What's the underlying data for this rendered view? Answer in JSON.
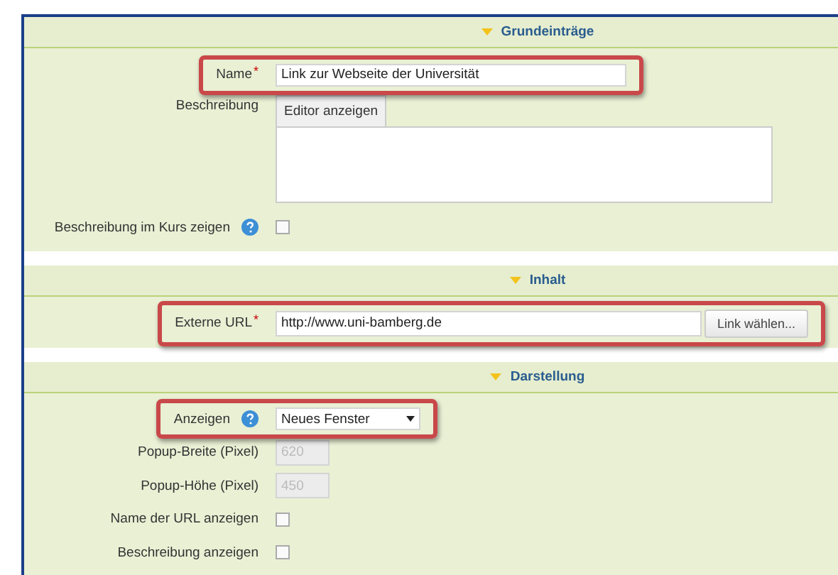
{
  "sections": [
    {
      "title": "Grundeinträge",
      "expanded": true,
      "fields": [
        {
          "kind": "text",
          "label": "Name",
          "required_mark": "*",
          "value": "Link zur Webseite der Universität",
          "highlighted": true
        },
        {
          "kind": "editor",
          "label": "Beschreibung",
          "tab": "Editor anzeigen"
        },
        {
          "kind": "checkbox",
          "label": "Beschreibung im Kurs zeigen",
          "help": true,
          "checked": false
        }
      ]
    },
    {
      "title": "Inhalt",
      "expanded": true,
      "fields": [
        {
          "kind": "url",
          "label": "Externe URL",
          "required_mark": "*",
          "value": "http://www.uni-bamberg.de",
          "button": "Link wählen...",
          "highlighted": true
        }
      ]
    },
    {
      "title": "Darstellung",
      "expanded": true,
      "fields": [
        {
          "kind": "select",
          "label": "Anzeigen",
          "help": true,
          "value": "Neues Fenster",
          "highlighted": true
        },
        {
          "kind": "number",
          "label": "Popup-Breite (Pixel)",
          "value": "620",
          "disabled": true
        },
        {
          "kind": "number",
          "label": "Popup-Höhe (Pixel)",
          "value": "450",
          "disabled": true
        },
        {
          "kind": "checkbox",
          "label": "Name der URL anzeigen",
          "checked": false
        },
        {
          "kind": "checkbox",
          "label": "Beschreibung anzeigen",
          "checked": false
        }
      ]
    }
  ]
}
